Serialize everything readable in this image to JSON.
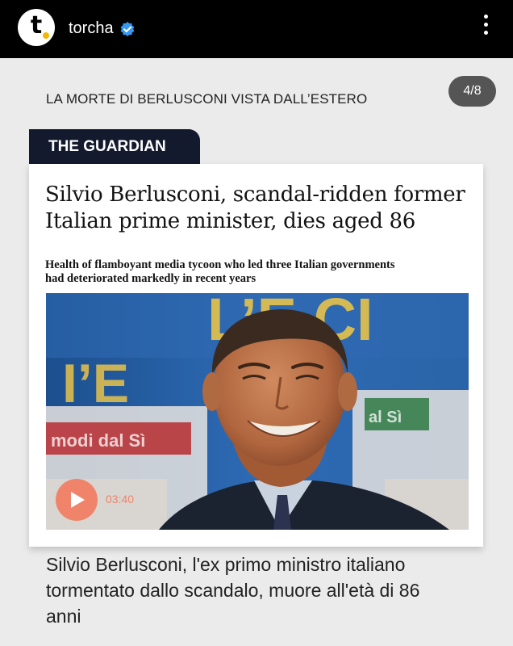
{
  "account": {
    "logo_letter": "t",
    "name": "torcha",
    "verified": true
  },
  "post": {
    "kicker": "LA MORTE DI BERLUSCONI VISTA DALL’ESTERO",
    "pager": "4/8",
    "source_label": "THE GUARDIAN",
    "headline": "Silvio Berlusconi, scandal-ridden former Italian prime minister, dies aged 86",
    "standfirst": "Health of flamboyant media tycoon who led three Italian governments had deteriorated markedly in recent years",
    "video": {
      "duration": "03:40"
    },
    "photo_background_text": [
      "L’E CI",
      "I’E",
      "modi dal Sì",
      "al Sì"
    ],
    "caption": "Silvio Berlusconi, l'ex primo ministro italiano tormentato dallo scandalo, muore all'età di 86 anni"
  },
  "colors": {
    "accent_orange": "#f0846a",
    "guardian_navy": "#141a2e",
    "verified_blue": "#3897f0",
    "logo_dot": "#f2b705"
  },
  "icons": [
    "torcha-logo-icon",
    "verified-badge-icon",
    "more-options-icon",
    "play-icon"
  ]
}
